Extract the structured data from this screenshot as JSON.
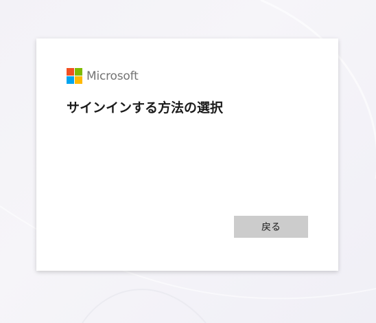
{
  "logo": {
    "text": "Microsoft",
    "colors": [
      "#f25022",
      "#7fba00",
      "#00a4ef",
      "#ffb900"
    ]
  },
  "title": "サインインする方法の選択",
  "buttons": {
    "back_label": "戻る"
  },
  "theme": {
    "button_background": "#cccccc",
    "card_background": "#ffffff"
  }
}
